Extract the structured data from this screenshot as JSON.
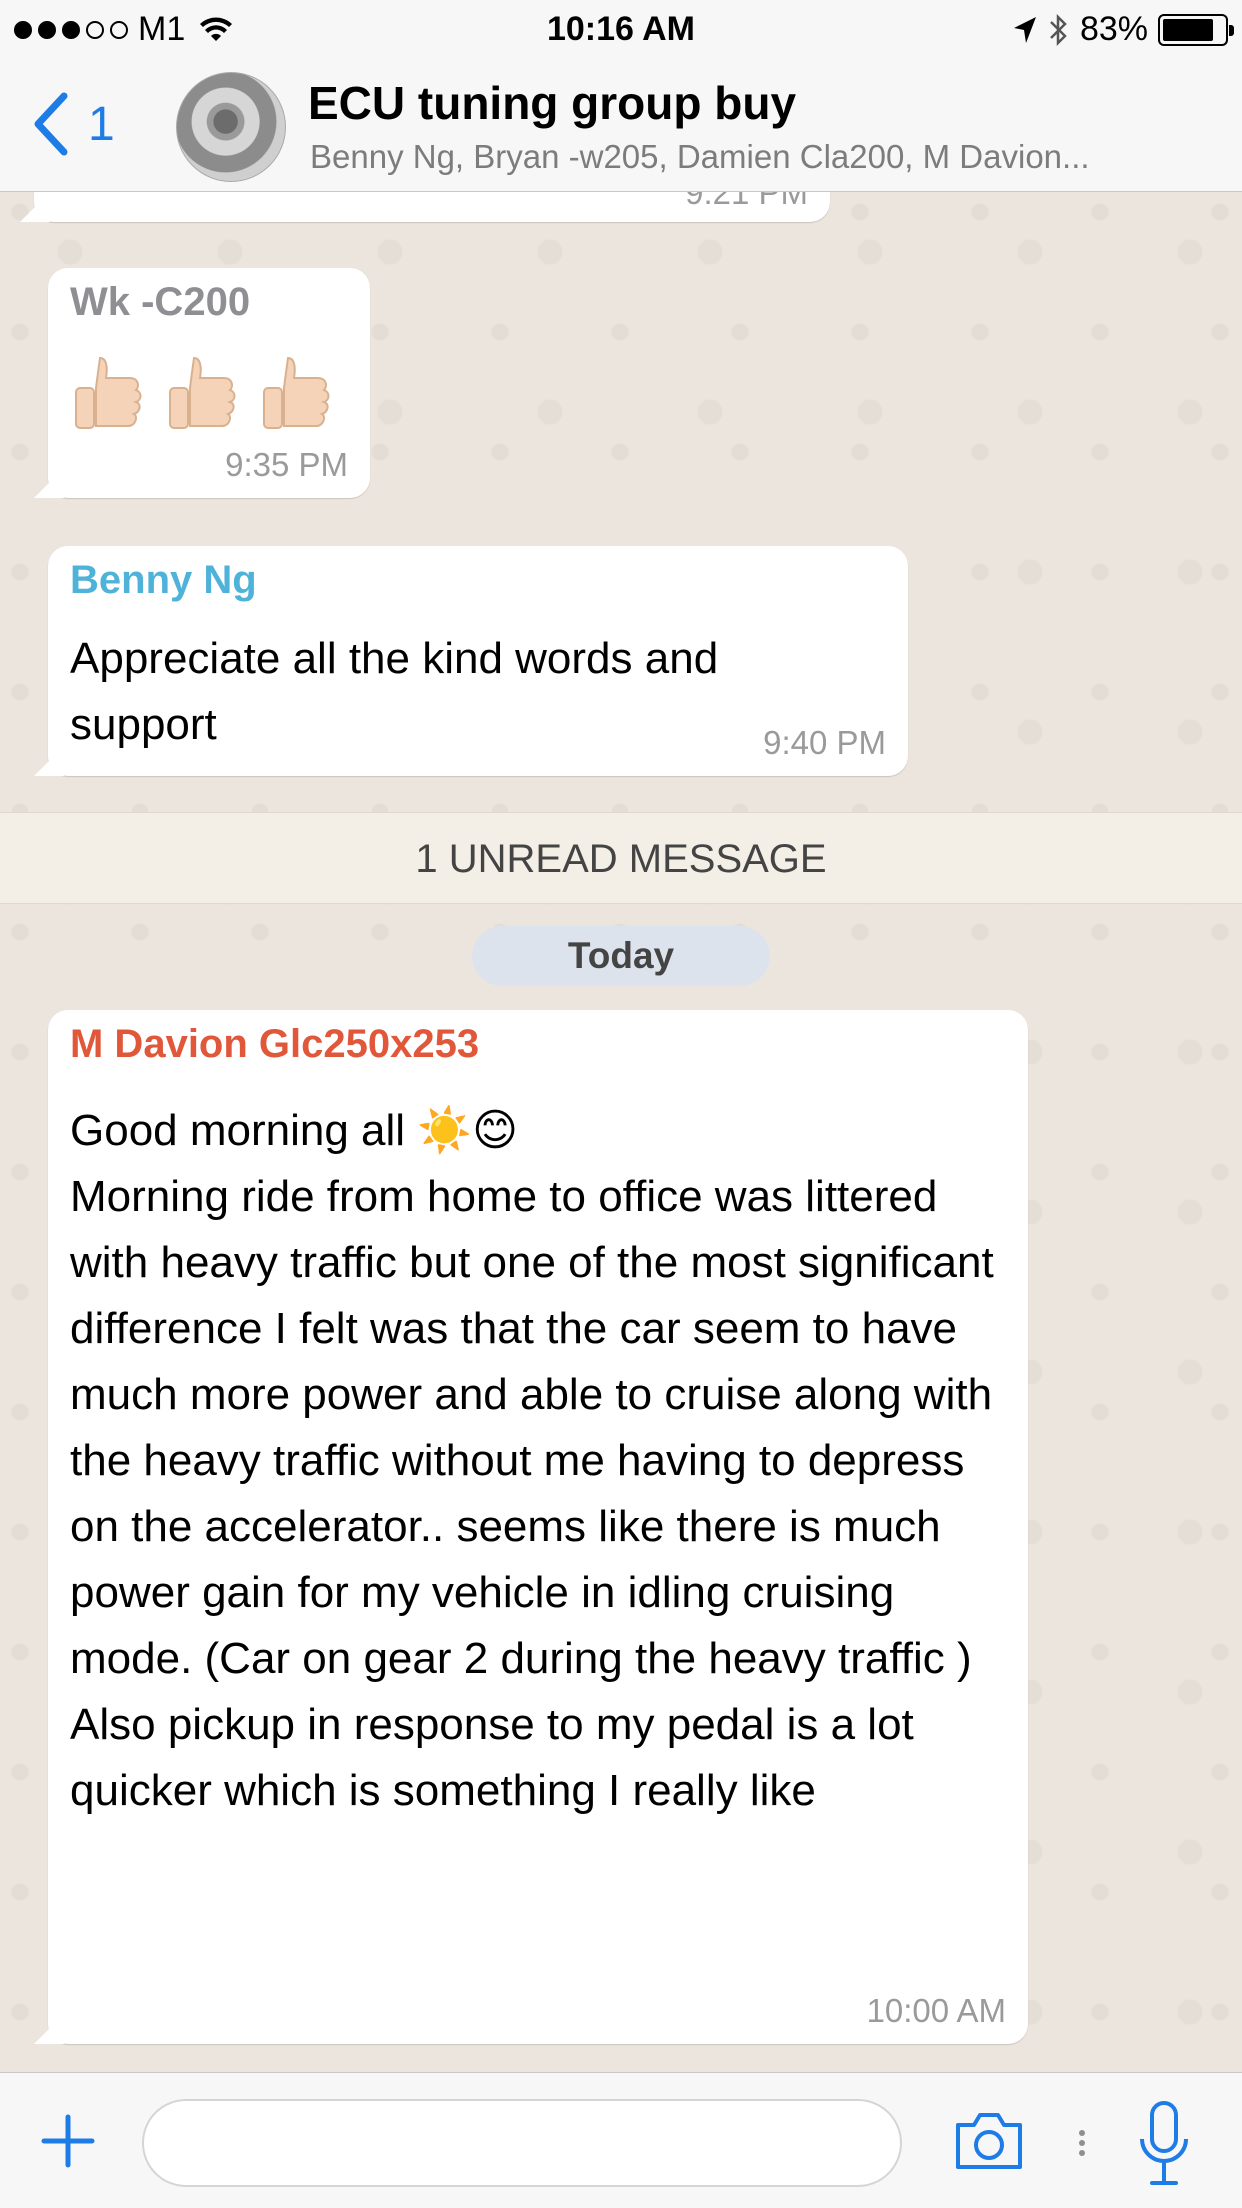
{
  "status_bar": {
    "carrier": "M1",
    "time": "10:16 AM",
    "battery": "83%",
    "battery_level": 0.83
  },
  "header": {
    "back_count": "1",
    "title": "ECU tuning group buy",
    "members": "Benny Ng, Bryan -w205, Damien Cla200, M Davion..."
  },
  "messages": [
    {
      "sender": "",
      "text": "",
      "time": "9:21 PM"
    },
    {
      "sender": "Wk -C200",
      "sender_color": "#8e8e93",
      "text": "👍🏻👍🏻👍🏻",
      "time": "9:35 PM"
    },
    {
      "sender": "Benny Ng",
      "sender_color": "#4fb3d9",
      "text": "Appreciate all the kind words and support",
      "time": "9:40 PM"
    },
    {
      "sender": "M Davion Glc250x253",
      "sender_color": "#e0573a",
      "text": "Good morning all ☀️😊\nMorning ride from home to office was littered with heavy traffic but one of the most significant difference I felt was that the car seem to have much more power and able to cruise along with the heavy traffic without me having to depress on the accelerator.. seems like there is much power gain for my vehicle in idling cruising mode. (Car on gear 2 during the heavy traffic )\nAlso pickup in response to my pedal is a lot quicker which is something I really like",
      "time": "10:00 AM"
    }
  ],
  "unread_banner": "1 UNREAD MESSAGE",
  "date_divider": "Today",
  "input": {
    "placeholder": ""
  },
  "icons": {
    "back": "chevron-left-icon",
    "plus": "plus-icon",
    "camera": "camera-icon",
    "more": "more-dots-icon",
    "mic": "microphone-icon"
  },
  "colors": {
    "accent": "#1e7ce6"
  }
}
